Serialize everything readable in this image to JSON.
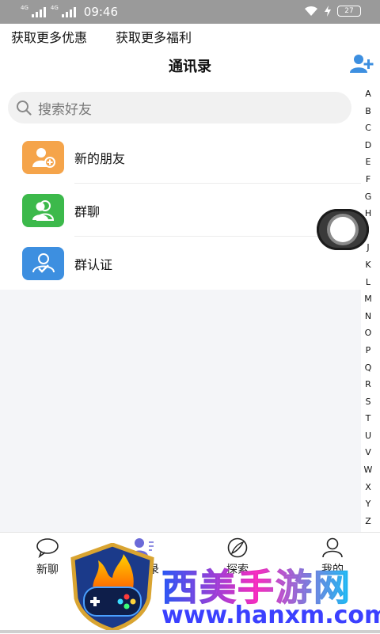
{
  "status_bar": {
    "net1": "4G",
    "net2": "4G",
    "time": "09:46",
    "battery": "27"
  },
  "promo": {
    "left": "获取更多优惠",
    "right": "获取更多福利"
  },
  "header": {
    "title": "通讯录",
    "add_icon": "add-user-icon"
  },
  "search": {
    "placeholder": "搜索好友",
    "icon": "search-icon"
  },
  "list": {
    "items": [
      {
        "label": "新的朋友",
        "icon": "new-friend-icon",
        "color": "#f5a44a"
      },
      {
        "label": "群聊",
        "icon": "group-chat-icon",
        "color": "#3cb94b"
      },
      {
        "label": "群认证",
        "icon": "group-verify-icon",
        "color": "#3d8fe0"
      }
    ]
  },
  "index_letters": [
    "A",
    "B",
    "C",
    "D",
    "E",
    "F",
    "G",
    "H",
    "I",
    "J",
    "K",
    "L",
    "M",
    "N",
    "O",
    "P",
    "Q",
    "R",
    "S",
    "T",
    "U",
    "V",
    "W",
    "X",
    "Y",
    "Z"
  ],
  "tabs": [
    {
      "label": "新聊",
      "icon": "chat-bubble-icon"
    },
    {
      "label": "通讯录",
      "icon": "contacts-icon",
      "active": true
    },
    {
      "label": "探索",
      "icon": "compass-icon"
    },
    {
      "label": "我的",
      "icon": "person-icon"
    }
  ],
  "watermark": {
    "title": "西美手游网",
    "url": "www.hanxm.com",
    "logo": "gamepad-shield-logo"
  },
  "colors": {
    "accent": "#3d8fe0",
    "active_tab": "#6b6ad8"
  }
}
